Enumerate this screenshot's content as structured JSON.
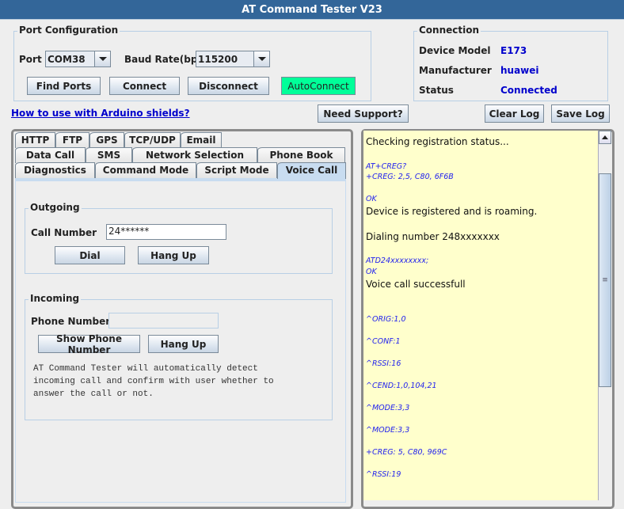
{
  "window": {
    "title": "AT Command Tester V23"
  },
  "port_config": {
    "title": "Port Configuration",
    "port_label": "Port",
    "port_value": "COM38",
    "baud_label": "Baud Rate(bps)",
    "baud_value": "115200",
    "find_ports": "Find Ports",
    "connect": "Connect",
    "disconnect": "Disconnect",
    "autoconnect": "AutoConnect",
    "autoconnect_color": "#00ff99"
  },
  "connection": {
    "title": "Connection",
    "device_model_label": "Device Model",
    "device_model": "E173",
    "manufacturer_label": "Manufacturer",
    "manufacturer": "huawei",
    "status_label": "Status",
    "status": "Connected",
    "value_color": "#0000cc"
  },
  "toolbar": {
    "arduino_link": "How to use with Arduino shields?",
    "need_support": "Need Support?",
    "clear_log": "Clear Log",
    "save_log": "Save Log"
  },
  "tabs": {
    "row1": [
      "HTTP",
      "FTP",
      "GPS",
      "TCP/UDP",
      "Email"
    ],
    "row2": [
      "Data Call",
      "SMS",
      "Network Selection",
      "Phone Book"
    ],
    "row3": [
      "Diagnostics",
      "Command Mode",
      "Script Mode",
      "Voice Call"
    ],
    "selected": "Voice Call"
  },
  "voice_call": {
    "outgoing": {
      "title": "Outgoing",
      "call_number_label": "Call Number",
      "call_number_value": "24******",
      "dial": "Dial",
      "hang_up": "Hang Up"
    },
    "incoming": {
      "title": "Incoming",
      "phone_number_label": "Phone Number",
      "phone_number_value": "",
      "show_phone_number": "Show Phone Number",
      "hang_up": "Hang Up",
      "note": [
        "AT Command Tester will automatically detect",
        "incoming call and confirm with user whether to",
        "answer the call or not."
      ]
    }
  },
  "log": {
    "lines": [
      {
        "text": "Checking registration status...",
        "kind": "msg"
      },
      {
        "text": "AT+CREG?",
        "kind": "at"
      },
      {
        "text": "+CREG: 2,5, C80, 6F6B",
        "kind": "at"
      },
      {
        "text": "OK",
        "kind": "at"
      },
      {
        "text": "Device is registered and is roaming.",
        "kind": "msg"
      },
      {
        "text": "Dialing number 248xxxxxxx",
        "kind": "msg"
      },
      {
        "text": "ATD24xxxxxxxx;",
        "kind": "at"
      },
      {
        "text": "OK",
        "kind": "at"
      },
      {
        "text": "Voice call successfull",
        "kind": "msg"
      },
      {
        "text": "^ORIG:1,0",
        "kind": "at"
      },
      {
        "text": "^CONF:1",
        "kind": "at"
      },
      {
        "text": "^RSSI:16",
        "kind": "at"
      },
      {
        "text": "^CEND:1,0,104,21",
        "kind": "at"
      },
      {
        "text": "^MODE:3,3",
        "kind": "at"
      },
      {
        "text": "^MODE:3,3",
        "kind": "at"
      },
      {
        "text": "+CREG: 5, C80, 969C",
        "kind": "at"
      },
      {
        "text": "^RSSI:19",
        "kind": "at"
      }
    ],
    "background": "#ffffcc"
  }
}
